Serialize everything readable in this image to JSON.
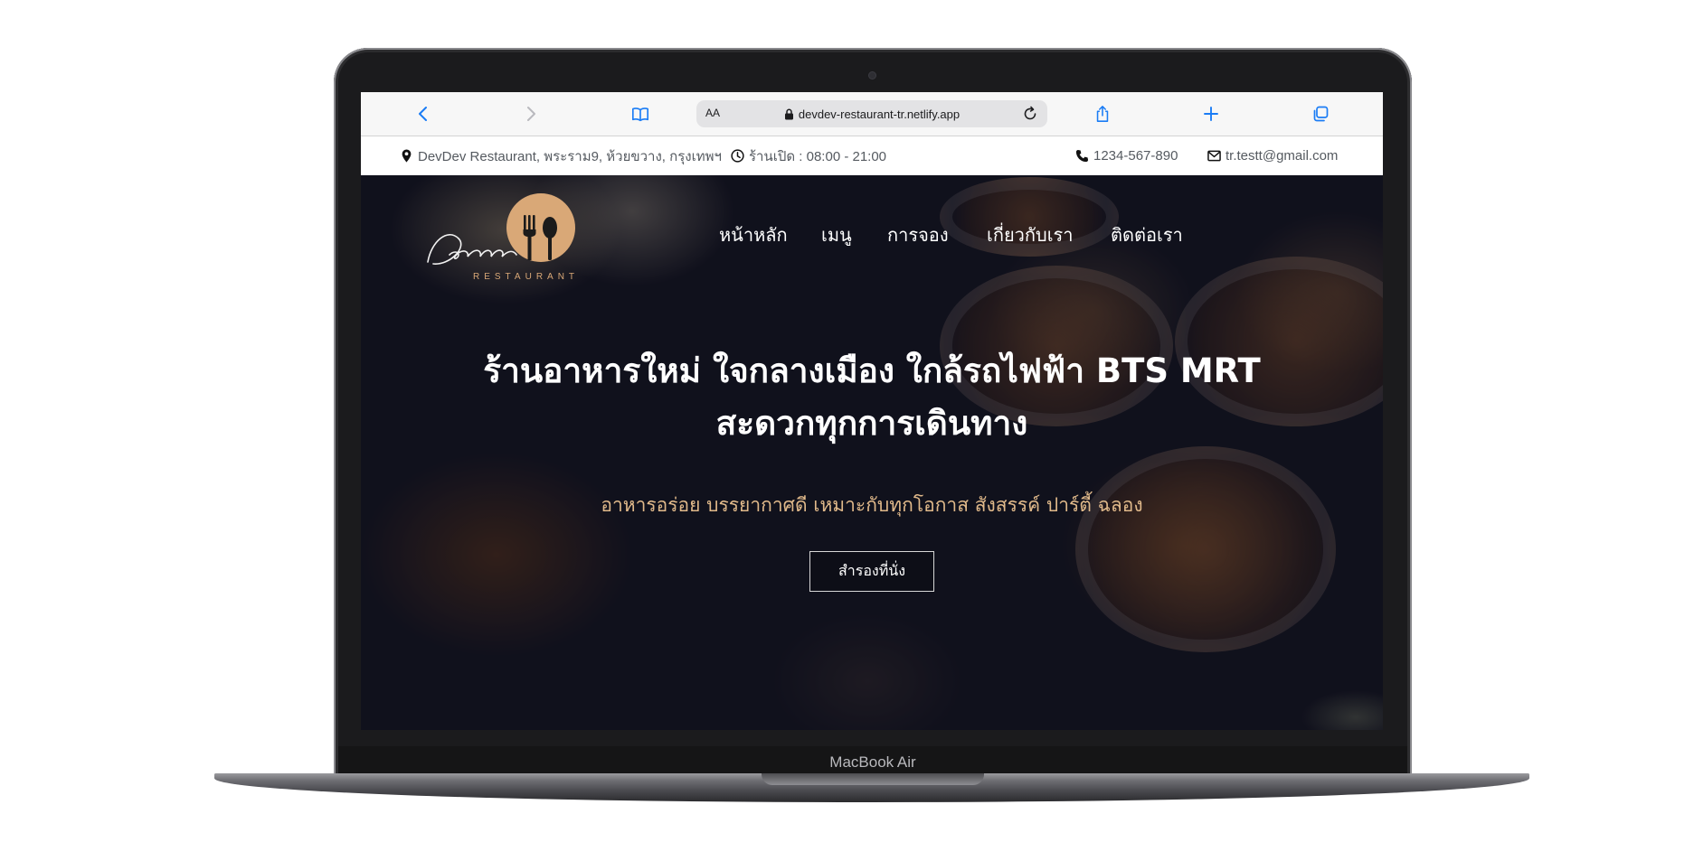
{
  "device": {
    "model_label": "MacBook Air"
  },
  "browser": {
    "text_size_label": "AA",
    "url": "devdev-restaurant-tr.netlify.app",
    "icons": {
      "back": "chevron-left-icon",
      "forward": "chevron-right-icon",
      "bookmarks": "book-icon",
      "lock": "lock-icon",
      "reload": "reload-icon",
      "share": "share-icon",
      "new_tab": "plus-icon",
      "tabs": "tabs-icon"
    },
    "accent_color": "#1a7cf5"
  },
  "infobar": {
    "address": "DevDev Restaurant, พระราม9, ห้วยขวาง, กรุงเทพฯ",
    "hours": "ร้านเปิด : 08:00 - 21:00",
    "phone": "1234-567-890",
    "email": "tr.testt@gmail.com"
  },
  "site": {
    "logo": {
      "script_text": "Devdev",
      "sub_text": "RESTAURANT",
      "color": "#d9a877"
    },
    "nav": [
      {
        "label": "หน้าหลัก"
      },
      {
        "label": "เมนู"
      },
      {
        "label": "การจอง"
      },
      {
        "label": "เกี่ยวกับเรา"
      },
      {
        "label": "ติดต่อเรา"
      }
    ],
    "hero": {
      "headline_line1": "ร้านอาหารใหม่ ใจกลางเมือง ใกล้รถไฟฟ้า BTS MRT",
      "headline_line2": "สะดวกทุกการเดินทาง",
      "subheadline": "อาหารอร่อย บรรยากาศดี เหมาะกับทุกโอกาส สังสรรค์ ปาร์ตี้ ฉลอง",
      "cta_label": "สำรองที่นั่ง",
      "subheadline_color": "#e0b98a"
    }
  }
}
